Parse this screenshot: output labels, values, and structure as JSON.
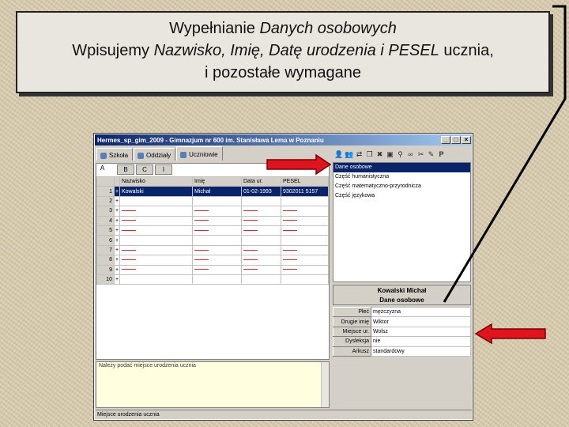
{
  "callout": {
    "line1_plain": "Wypełnianie ",
    "line1_italic": "Danych osobowych",
    "line2_plain_a": "Wpisujemy ",
    "line2_italic": "Nazwisko, Imię, Datę urodzenia i PESEL",
    "line2_plain_b": " ucznia,",
    "line3": "i pozostałe wymagane"
  },
  "window": {
    "title": "Hermes_sp_gim_2009 - Gimnazjum nr 600 im. Stanisława Lema w Poznaniu",
    "tabs": [
      "Szkoła",
      "Oddziały",
      "Uczniowie"
    ],
    "active_tab": "Uczniowie",
    "toolbar_last": "P"
  },
  "grid": {
    "column_label": "A",
    "sheet_tabs": [
      "B",
      "C",
      "I"
    ],
    "headers": [
      "Nazwisko",
      "Imię",
      "Data ur.",
      "PESEL"
    ],
    "rows": [
      {
        "n": "1",
        "mark": "+",
        "nazwisko": "Kowalski",
        "imie": "Michał",
        "data": "01-02-1993",
        "pesel": "9302011 5157",
        "selected": true
      },
      {
        "n": "2",
        "mark": "+"
      },
      {
        "n": "3",
        "mark": "+",
        "dashed": true
      },
      {
        "n": "4",
        "mark": "+",
        "dashed": true
      },
      {
        "n": "5",
        "mark": "+",
        "dashed": true
      },
      {
        "n": "6",
        "mark": "+"
      },
      {
        "n": "7",
        "mark": "+",
        "dashed": true
      },
      {
        "n": "8",
        "mark": "+",
        "dashed": true
      },
      {
        "n": "9",
        "mark": "+",
        "dashed": true
      },
      {
        "n": "10",
        "mark": "+"
      }
    ]
  },
  "note": "Należy podać miejsce urodzenia ucznia",
  "status": "Miejsce urodzenia ucznia",
  "list": {
    "items": [
      "Dane osobowe",
      "Część humanistyczna",
      "Część matematyczno-przyrodnicza",
      "Część językowa"
    ],
    "selected": "Dane osobowe"
  },
  "person": {
    "name": "Kowalski Michał",
    "section": "Dane osobowe"
  },
  "props": [
    {
      "k": "Płeć",
      "v": "mężczyzna"
    },
    {
      "k": "Drugie imię",
      "v": "Wiktor"
    },
    {
      "k": "Miejsce ur.",
      "v": "Wolsz"
    },
    {
      "k": "Dysleksja",
      "v": "nie"
    },
    {
      "k": "Arkusz",
      "v": "standardowy"
    }
  ],
  "colors": {
    "arrow": "#e0141e",
    "selection": "#0a246a"
  }
}
